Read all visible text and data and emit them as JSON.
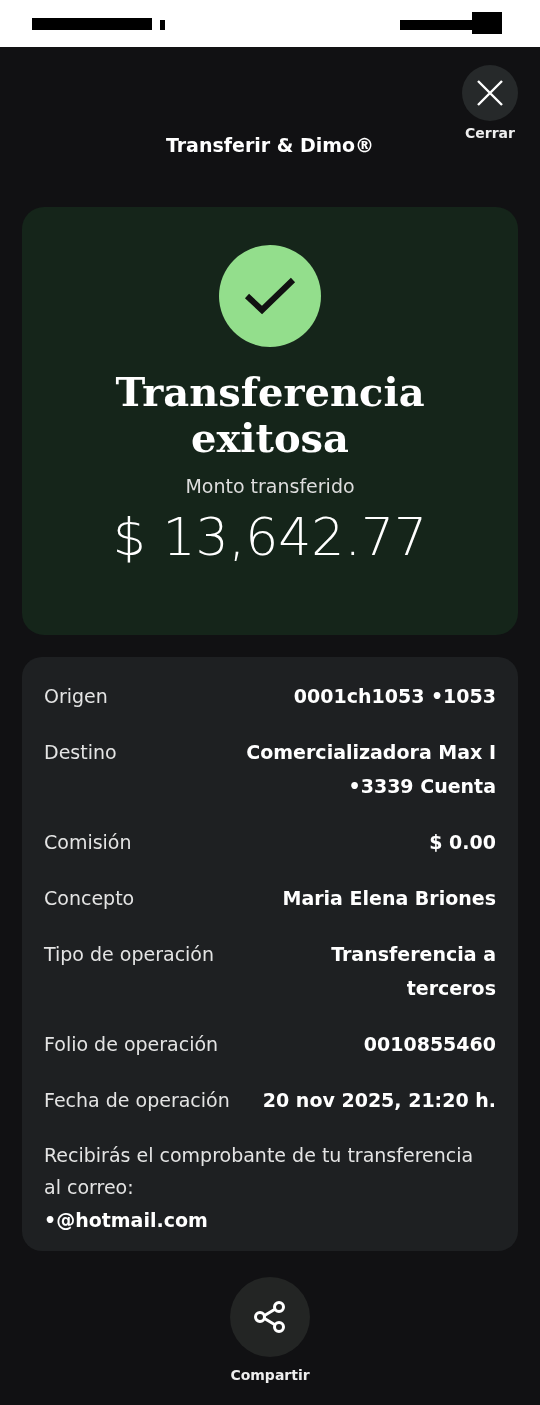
{
  "header": {
    "title": "Transferir & Dimo®",
    "close_label": "Cerrar"
  },
  "result": {
    "title": "Transferencia exitosa",
    "amount_label": "Monto transferido",
    "amount": "$ 13,642.77"
  },
  "details": [
    {
      "label": "Origen",
      "value": "0001ch1053 •1053"
    },
    {
      "label": "Destino",
      "value": "Comercializadora Max I •3339 Cuenta"
    },
    {
      "label": "Comisión",
      "value": "$ 0.00"
    },
    {
      "label": "Concepto",
      "value": "Maria Elena Briones"
    },
    {
      "label": "Tipo de operación",
      "value": "Transferencia a terceros"
    },
    {
      "label": "Folio de operación",
      "value": "0010855460"
    },
    {
      "label": "Fecha de operación",
      "value": "20 nov 2025, 21:20 h."
    }
  ],
  "notice": {
    "text": "Recibirás el comprobante de tu transferencia al correo:",
    "email": "•@hotmail.com"
  },
  "share": {
    "label": "Compartir"
  }
}
